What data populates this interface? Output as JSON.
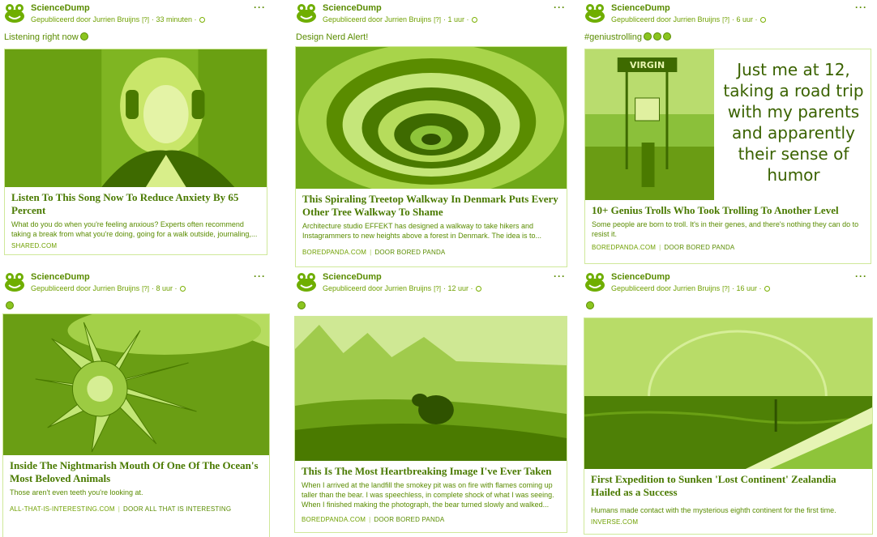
{
  "posts": [
    {
      "page_name": "ScienceDump",
      "published_by": "Gepubliceerd door Jurrien Bruijns",
      "help": "[?]",
      "time": "33 minuten",
      "status_text": "Listening right now",
      "status_emoji": "smile",
      "card": {
        "title": "Listen To This Song Now To Reduce Anxiety By 65 Percent",
        "description": "What do you do when you're feeling anxious? Experts often recommend taking a break from what you're doing, going for a walk outside, journaling,...",
        "source": "SHARED.COM",
        "author": ""
      }
    },
    {
      "page_name": "ScienceDump",
      "published_by": "Gepubliceerd door Jurrien Bruijns",
      "help": "[?]",
      "time": "1 uur",
      "status_text": "Design Nerd Alert!",
      "status_emoji": "",
      "card": {
        "title": "This Spiraling Treetop Walkway In Denmark Puts Every Other Tree Walkway To Shame",
        "description": "Architecture studio EFFEKT has designed a walkway to take hikers and Instagrammers to new heights above a forest in Denmark. The idea is to...",
        "source": "BOREDPANDA.COM",
        "author": "DOOR BORED PANDA"
      }
    },
    {
      "page_name": "ScienceDump",
      "published_by": "Gepubliceerd door Jurrien Bruijns",
      "help": "[?]",
      "time": "6 uur",
      "status_text": "#geniustrolling",
      "status_emoji": "laugh x3",
      "card": {
        "title": "10+ Genius Trolls Who Took Trolling To Another Level",
        "description": "Some people are born to troll. It's in their genes, and there's nothing they can do to resist it.",
        "source": "BOREDPANDA.COM",
        "author": "DOOR BORED PANDA",
        "sign_text": "VIRGIN",
        "meme_text": "Just me at 12, taking a road trip with my parents and apparently their sense of humor"
      }
    },
    {
      "page_name": "ScienceDump",
      "published_by": "Gepubliceerd door Jurrien Bruijns",
      "help": "[?]",
      "time": "8 uur",
      "status_text": "",
      "status_emoji": "scream",
      "card": {
        "title": "Inside The Nightmarish Mouth Of One Of The Ocean's Most Beloved Animals",
        "description": "Those aren't even teeth you're looking at.",
        "source": "ALL-THAT-IS-INTERESTING.COM",
        "author": "DOOR ALL THAT IS INTERESTING"
      }
    },
    {
      "page_name": "ScienceDump",
      "published_by": "Gepubliceerd door Jurrien Bruijns",
      "help": "[?]",
      "time": "12 uur",
      "status_text": "",
      "status_emoji": "sad",
      "card": {
        "title": "This Is The Most Heartbreaking Image I've Ever Taken",
        "description": "When I arrived at the landfill the smokey pit was on fire with flames coming up taller than the bear. I was speechless, in complete shock of what I was seeing. When I finished making the photograph, the bear turned slowly and walked...",
        "source": "BOREDPANDA.COM",
        "author": "DOOR BORED PANDA"
      }
    },
    {
      "page_name": "ScienceDump",
      "published_by": "Gepubliceerd door Jurrien Bruijns",
      "help": "[?]",
      "time": "16 uur",
      "status_text": "",
      "status_emoji": "grin",
      "card": {
        "title": "First Expedition to Sunken 'Lost Continent' Zealandia Hailed as a Success",
        "description": "Humans made contact with the mysterious eighth continent for the first time.",
        "source": "INVERSE.COM",
        "author": ""
      }
    }
  ],
  "more_label": "···",
  "separator": "·",
  "source_sep": "|",
  "colors": {
    "tint": "#8bc520",
    "dark": "#4a7a00",
    "border": "#cfe89a"
  }
}
